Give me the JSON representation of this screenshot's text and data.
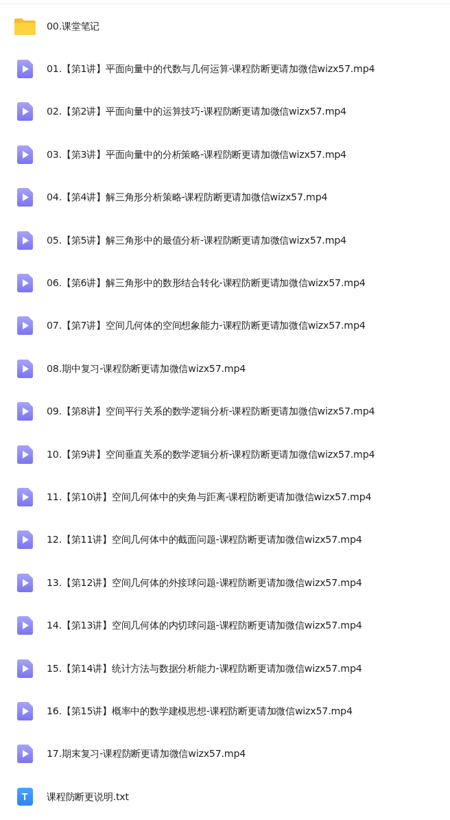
{
  "files": [
    {
      "kind": "folder",
      "name": "00.课堂笔记"
    },
    {
      "kind": "video",
      "name": "01.【第1讲】平面向量中的代数与几何运算-课程防断更请加微信wizx57.mp4"
    },
    {
      "kind": "video",
      "name": "02.【第2讲】平面向量中的运算技巧-课程防断更请加微信wizx57.mp4"
    },
    {
      "kind": "video",
      "name": "03.【第3讲】平面向量中的分析策略-课程防断更请加微信wizx57.mp4"
    },
    {
      "kind": "video",
      "name": "04.【第4讲】解三角形分析策略-课程防断更请加微信wizx57.mp4"
    },
    {
      "kind": "video",
      "name": "05.【第5讲】解三角形中的最值分析-课程防断更请加微信wizx57.mp4"
    },
    {
      "kind": "video",
      "name": "06.【第6讲】解三角形中的数形结合转化-课程防断更请加微信wizx57.mp4"
    },
    {
      "kind": "video",
      "name": "07.【第7讲】空间几何体的空间想象能力-课程防断更请加微信wizx57.mp4"
    },
    {
      "kind": "video",
      "name": "08.期中复习-课程防断更请加微信wizx57.mp4"
    },
    {
      "kind": "video",
      "name": "09.【第8讲】空间平行关系的数学逻辑分析-课程防断更请加微信wizx57.mp4"
    },
    {
      "kind": "video",
      "name": "10.【第9讲】空间垂直关系的数学逻辑分析-课程防断更请加微信wizx57.mp4"
    },
    {
      "kind": "video",
      "name": "11.【第10讲】空间几何体中的夹角与距离-课程防断更请加微信wizx57.mp4"
    },
    {
      "kind": "video",
      "name": "12.【第11讲】空间几何体中的截面问题-课程防断更请加微信wizx57.mp4"
    },
    {
      "kind": "video",
      "name": "13.【第12讲】空间几何体的外接球问题-课程防断更请加微信wizx57.mp4"
    },
    {
      "kind": "video",
      "name": "14.【第13讲】空间几何体的内切球问题-课程防断更请加微信wizx57.mp4"
    },
    {
      "kind": "video",
      "name": "15.【第14讲】统计方法与数据分析能力-课程防断更请加微信wizx57.mp4"
    },
    {
      "kind": "video",
      "name": "16.【第15讲】概率中的数学建模思想-课程防断更请加微信wizx57.mp4"
    },
    {
      "kind": "video",
      "name": "17.期末复习-课程防断更请加微信wizx57.mp4"
    },
    {
      "kind": "text",
      "name": "课程防断更说明.txt",
      "icon_letter": "T"
    }
  ]
}
